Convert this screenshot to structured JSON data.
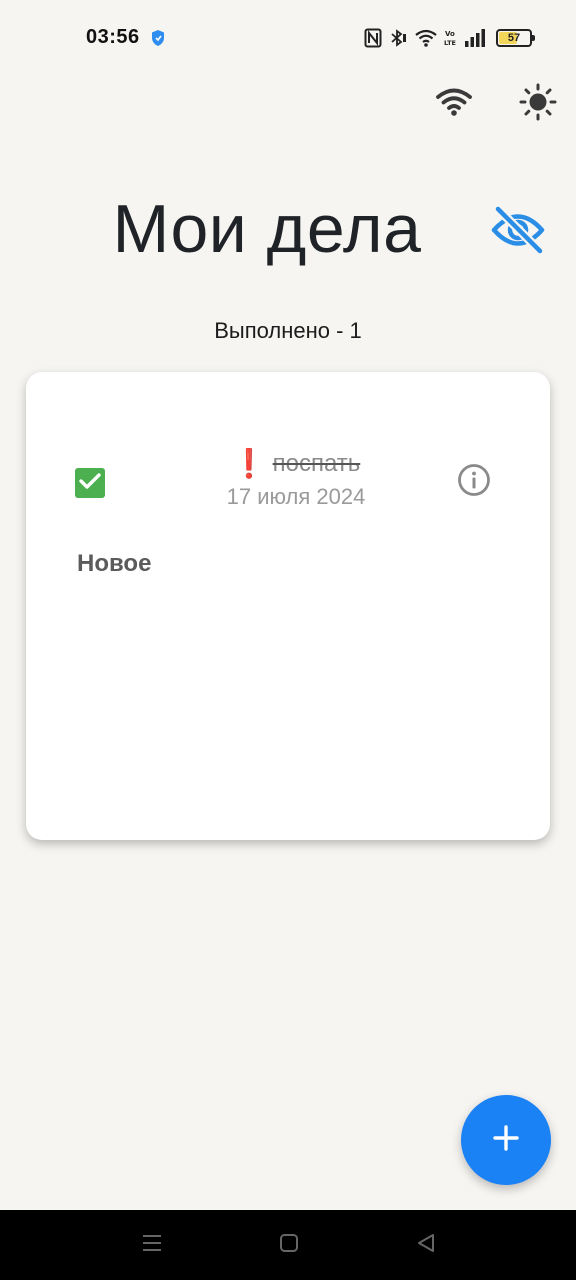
{
  "status_bar": {
    "time": "03:56",
    "battery_level": "57",
    "battery_fraction": 0.57,
    "icons": [
      "shield-icon",
      "nfc-icon",
      "bluetooth-icon",
      "wifi-icon",
      "volte-icon",
      "signal-icon",
      "battery-icon"
    ]
  },
  "toolbar": {
    "wifi_icon": "wifi-icon",
    "theme_icon": "sun-icon"
  },
  "header": {
    "title": "Мои дела",
    "visibility_icon": "visibility-off-icon",
    "done_counter": "Выполнено - 1"
  },
  "tasks": [
    {
      "title": "поспать",
      "date": "17 июля 2024",
      "completed": true,
      "priority_icon": "❗",
      "priority": "high"
    }
  ],
  "new_item_label": "Новое",
  "fab": {
    "icon": "plus-icon"
  },
  "colors": {
    "background": "#f6f5f2",
    "accent": "#1a82f5",
    "checkbox": "#4caf50",
    "priority": "#e53935"
  }
}
